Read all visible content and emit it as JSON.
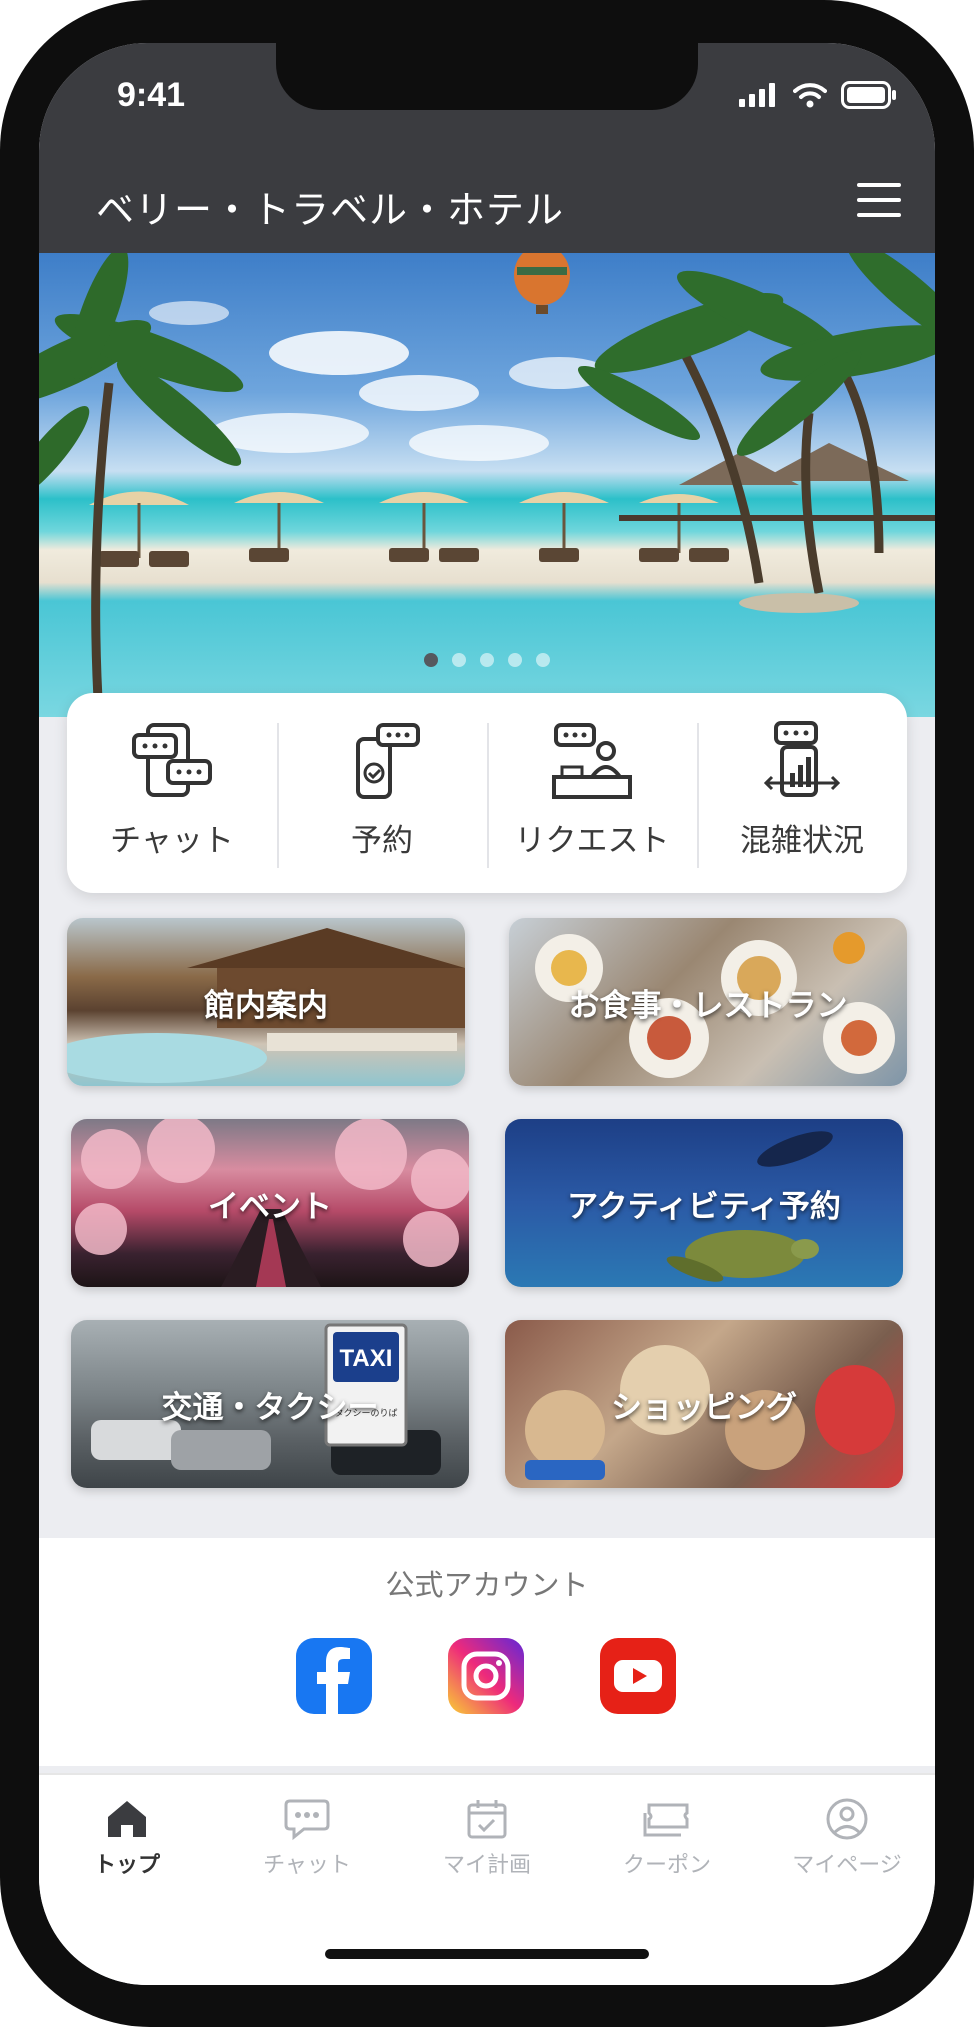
{
  "status_bar": {
    "time": "9:41"
  },
  "header": {
    "title": "ベリー・トラベル・ホテル",
    "menu_icon": "hamburger-menu-icon"
  },
  "hero": {
    "slides_total": 5,
    "active_slide": 1
  },
  "quick_actions": [
    {
      "label": "チャット",
      "icon": "chat-bubbles-icon"
    },
    {
      "label": "予約",
      "icon": "phone-check-icon"
    },
    {
      "label": "リクエスト",
      "icon": "concierge-desk-icon"
    },
    {
      "label": "混雑状況",
      "icon": "congestion-chart-icon"
    }
  ],
  "tiles": [
    {
      "label": "館内案内"
    },
    {
      "label": "お食事・レストラン"
    },
    {
      "label": "イベント"
    },
    {
      "label": "アクティビティ予約"
    },
    {
      "label": "交通・タクシー",
      "sign_text": "TAXI",
      "sign_sub": "タクシーのりば"
    },
    {
      "label": "ショッピング"
    }
  ],
  "official_accounts": {
    "title": "公式アカウント",
    "links": [
      {
        "name": "facebook",
        "icon": "facebook-icon",
        "color": "#1877f2"
      },
      {
        "name": "instagram",
        "icon": "instagram-icon",
        "color": "#d6249f"
      },
      {
        "name": "youtube",
        "icon": "youtube-icon",
        "color": "#e62117"
      }
    ]
  },
  "tabbar": {
    "items": [
      {
        "label": "トップ",
        "icon": "home-icon",
        "active": true
      },
      {
        "label": "チャット",
        "icon": "chat-icon",
        "active": false
      },
      {
        "label": "マイ計画",
        "icon": "calendar-icon",
        "active": false
      },
      {
        "label": "クーポン",
        "icon": "coupon-icon",
        "active": false
      },
      {
        "label": "マイページ",
        "icon": "user-icon",
        "active": false
      }
    ]
  }
}
